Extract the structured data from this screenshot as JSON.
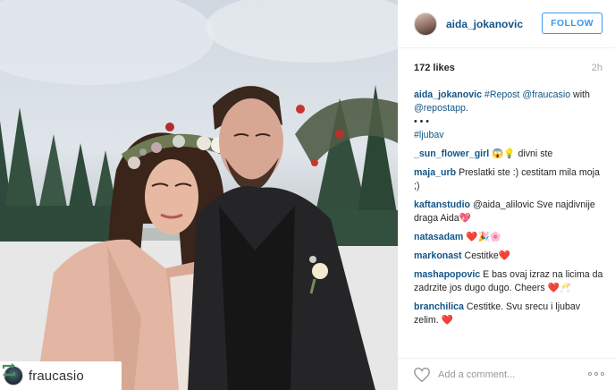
{
  "post": {
    "repost_username": "fraucasio",
    "owner_username": "aida_jokanovic",
    "follow_label": "FOLLOW",
    "likes": "172 likes",
    "time": "2h"
  },
  "comments": [
    {
      "user": "aida_jokanovic",
      "text": "#Repost @fraucasio with @repostapp. • • • #ljubav"
    },
    {
      "user": "_sun_flower_girl",
      "text": "😱💡 divni ste"
    },
    {
      "user": "maja_urb",
      "text": "Preslatki ste :) cestitam mila moja ;)"
    },
    {
      "user": "kaftanstudio",
      "text": "@aida_alilovic Sve najdivnije draga Aida💖"
    },
    {
      "user": "natasadam",
      "text": "❤️🎉🌸"
    },
    {
      "user": "markonast",
      "text": "Cestitke❤️"
    },
    {
      "user": "mashapopovic",
      "text": "E bas ovaj izraz na licima da zadrzite jos dugo dugo. Cheers ❤️🥂"
    },
    {
      "user": "branchilica",
      "text": "Cestitke. Svu srecu i ljubav zelim. ❤️"
    }
  ],
  "caption_parts": {
    "repost_tag": "#Repost",
    "mention": "@fraucasio",
    "with": " with",
    "app": "@repostapp",
    "dot": ".",
    "dots": "• • •",
    "hashtag": "#ljubav"
  },
  "add_comment": {
    "placeholder": "Add a comment..."
  },
  "icons": {
    "repost": "repost-icon",
    "heart": "heart-icon",
    "more": "more-options-icon"
  },
  "colors": {
    "link": "#125688",
    "follow": "#3897f0",
    "muted": "#a5a7aa"
  }
}
